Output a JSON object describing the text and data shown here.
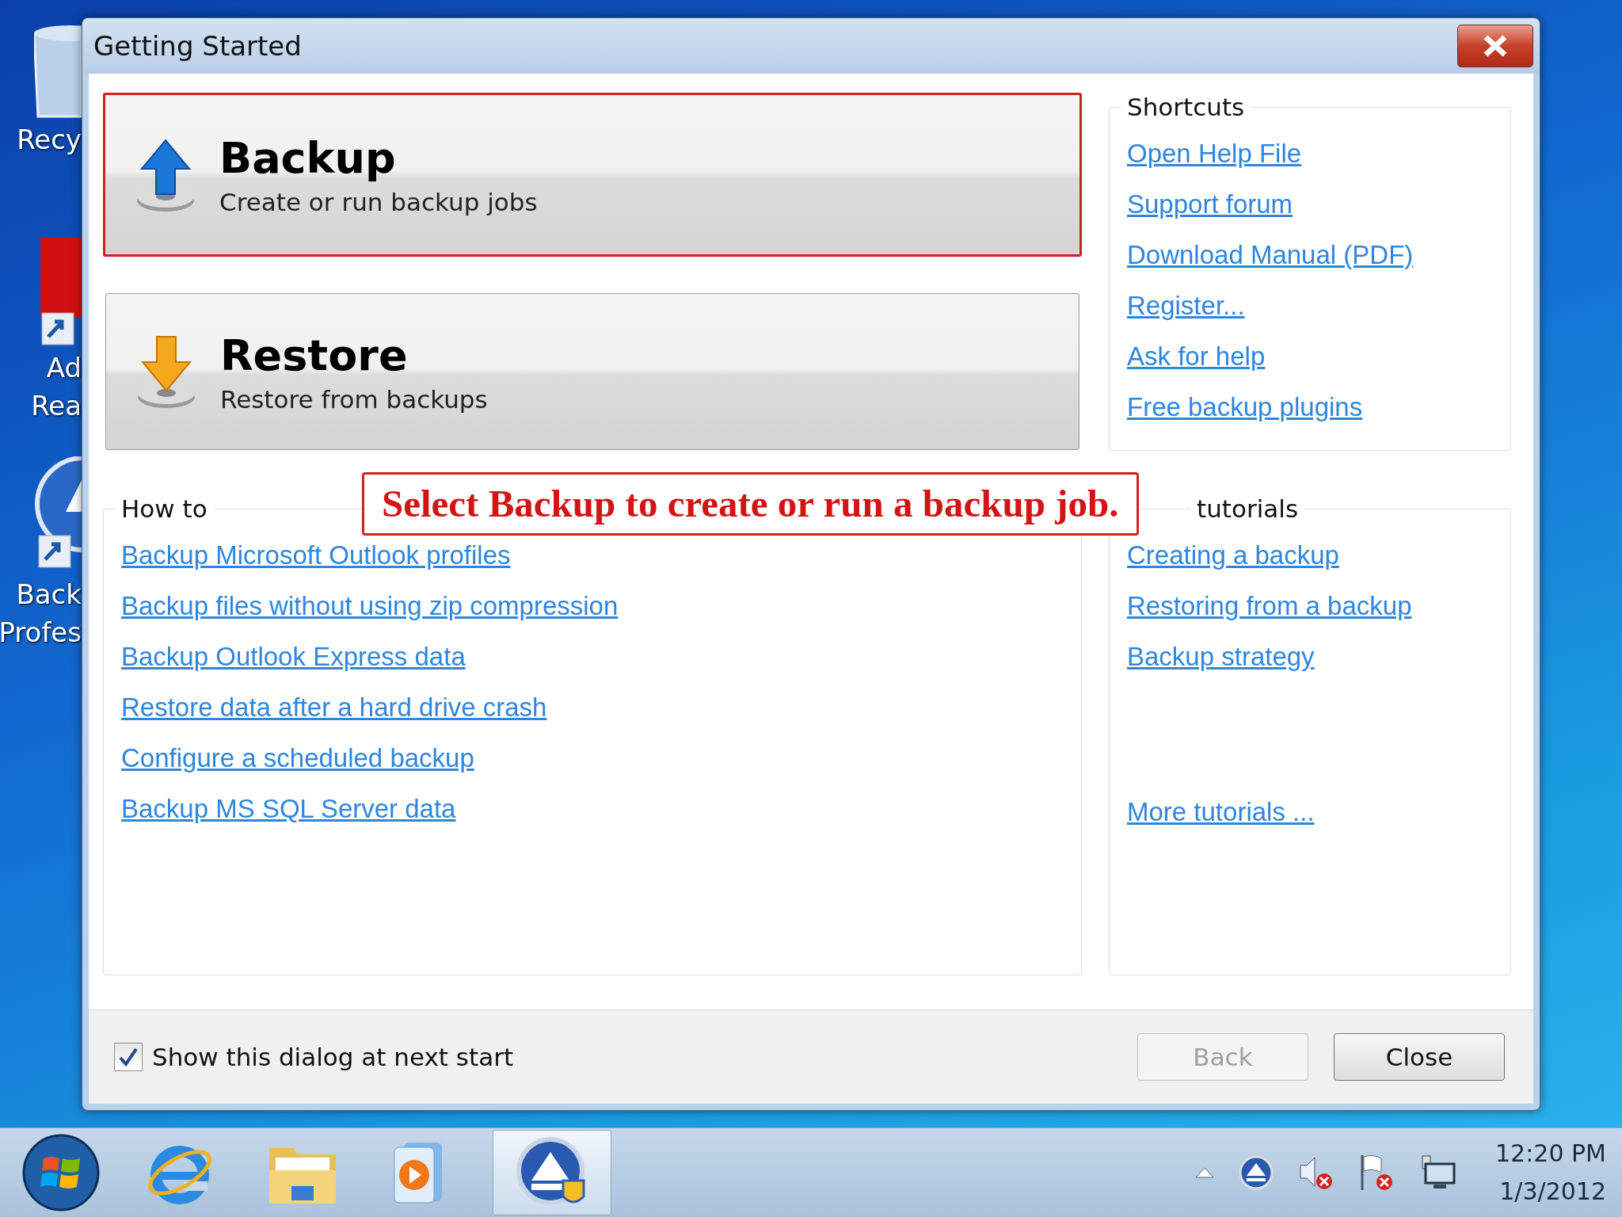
{
  "desktop": {
    "icons": [
      {
        "kind": "recycle",
        "lines": [
          "Recy"
        ]
      },
      {
        "kind": "reader",
        "lines": [
          "Ad",
          "Rea"
        ]
      },
      {
        "kind": "backup",
        "lines": [
          "Back",
          "Profes"
        ]
      }
    ]
  },
  "dialog": {
    "title": "Getting Started",
    "actions": [
      {
        "kind": "backup",
        "title": "Backup",
        "subtitle": "Create or run backup jobs",
        "selected": true
      },
      {
        "kind": "restore",
        "title": "Restore",
        "subtitle": "Restore from backups",
        "selected": false
      }
    ],
    "shortcuts": {
      "title": "Shortcuts",
      "links": [
        "Open Help File",
        "Support forum",
        "Download Manual (PDF)",
        "Register...",
        "Ask for help",
        "Free backup plugins"
      ]
    },
    "how_to": {
      "title": "How to",
      "links": [
        "Backup Microsoft Outlook profiles",
        "Backup files without using zip compression",
        "Backup Outlook Express data",
        "Restore data after a hard drive crash",
        "Configure a scheduled backup",
        "Backup MS SQL Server data"
      ]
    },
    "tutorials": {
      "title": "tutorials",
      "links": [
        "Creating a backup",
        "Restoring from a backup",
        "Backup strategy"
      ],
      "more": "More tutorials ..."
    },
    "callout": "Select Backup to create or run a backup job.",
    "footer": {
      "checkbox": {
        "label": "Show this dialog at next start",
        "checked": true
      },
      "buttons": [
        {
          "label": "Back",
          "disabled": true
        },
        {
          "label": "Close",
          "disabled": false
        }
      ]
    }
  },
  "taskbar": {
    "apps": [
      {
        "kind": "start",
        "selected": false
      },
      {
        "kind": "browser",
        "selected": false
      },
      {
        "kind": "folder",
        "selected": false
      },
      {
        "kind": "media",
        "selected": false
      },
      {
        "kind": "backup",
        "selected": true
      }
    ],
    "tray": [
      {
        "kind": "arrow"
      },
      {
        "kind": "backup"
      },
      {
        "kind": "speaker"
      },
      {
        "kind": "flag"
      },
      {
        "kind": "network"
      }
    ],
    "time": "12:20 PM",
    "date": "1/3/2012"
  }
}
